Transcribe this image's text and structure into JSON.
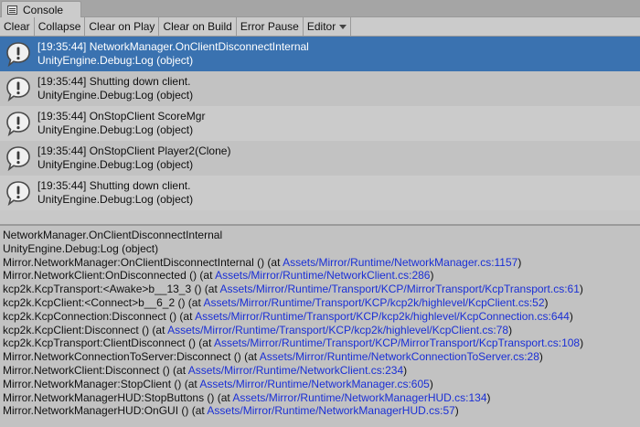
{
  "window": {
    "tab_title": "Console",
    "tab_icon": "console-list-icon"
  },
  "toolbar": {
    "buttons": [
      "Clear",
      "Collapse",
      "Clear on Play",
      "Clear on Build",
      "Error Pause",
      "Editor"
    ]
  },
  "logs": [
    {
      "message": "[19:35:44] NetworkManager.OnClientDisconnectInternal",
      "source": "UnityEngine.Debug:Log (object)",
      "selected": true
    },
    {
      "message": "[19:35:44] Shutting down client.",
      "source": "UnityEngine.Debug:Log (object)",
      "selected": false
    },
    {
      "message": "[19:35:44] OnStopClient ScoreMgr",
      "source": "UnityEngine.Debug:Log (object)",
      "selected": false
    },
    {
      "message": "[19:35:44] OnStopClient Player2(Clone)",
      "source": "UnityEngine.Debug:Log (object)",
      "selected": false
    },
    {
      "message": "[19:35:44] Shutting down client.",
      "source": "UnityEngine.Debug:Log (object)",
      "selected": false
    }
  ],
  "detail": {
    "header": [
      "NetworkManager.OnClientDisconnectInternal",
      "UnityEngine.Debug:Log (object)"
    ],
    "stack": [
      {
        "call": "Mirror.NetworkManager:OnClientDisconnectInternal () (at ",
        "link": "Assets/Mirror/Runtime/NetworkManager.cs:1157",
        "end": ")"
      },
      {
        "call": "Mirror.NetworkClient:OnDisconnected () (at ",
        "link": "Assets/Mirror/Runtime/NetworkClient.cs:286",
        "end": ")"
      },
      {
        "call": "kcp2k.KcpTransport:<Awake>b__13_3 () (at ",
        "link": "Assets/Mirror/Runtime/Transport/KCP/MirrorTransport/KcpTransport.cs:61",
        "end": ")"
      },
      {
        "call": "kcp2k.KcpClient:<Connect>b__6_2 () (at ",
        "link": "Assets/Mirror/Runtime/Transport/KCP/kcp2k/highlevel/KcpClient.cs:52",
        "end": ")"
      },
      {
        "call": "kcp2k.KcpConnection:Disconnect () (at ",
        "link": "Assets/Mirror/Runtime/Transport/KCP/kcp2k/highlevel/KcpConnection.cs:644",
        "end": ")"
      },
      {
        "call": "kcp2k.KcpClient:Disconnect () (at ",
        "link": "Assets/Mirror/Runtime/Transport/KCP/kcp2k/highlevel/KcpClient.cs:78",
        "end": ")"
      },
      {
        "call": "kcp2k.KcpTransport:ClientDisconnect () (at ",
        "link": "Assets/Mirror/Runtime/Transport/KCP/MirrorTransport/KcpTransport.cs:108",
        "end": ")"
      },
      {
        "call": "Mirror.NetworkConnectionToServer:Disconnect () (at ",
        "link": "Assets/Mirror/Runtime/NetworkConnectionToServer.cs:28",
        "end": ")"
      },
      {
        "call": "Mirror.NetworkClient:Disconnect () (at ",
        "link": "Assets/Mirror/Runtime/NetworkClient.cs:234",
        "end": ")"
      },
      {
        "call": "Mirror.NetworkManager:StopClient () (at ",
        "link": "Assets/Mirror/Runtime/NetworkManager.cs:605",
        "end": ")"
      },
      {
        "call": "Mirror.NetworkManagerHUD:StopButtons () (at ",
        "link": "Assets/Mirror/Runtime/NetworkManagerHUD.cs:134",
        "end": ")"
      },
      {
        "call": "Mirror.NetworkManagerHUD:OnGUI () (at ",
        "link": "Assets/Mirror/Runtime/NetworkManagerHUD.cs:57",
        "end": ")"
      }
    ]
  },
  "colors": {
    "selection": "#3a72b0",
    "link": "#1a2fd6",
    "panel": "#c2c2c2"
  }
}
